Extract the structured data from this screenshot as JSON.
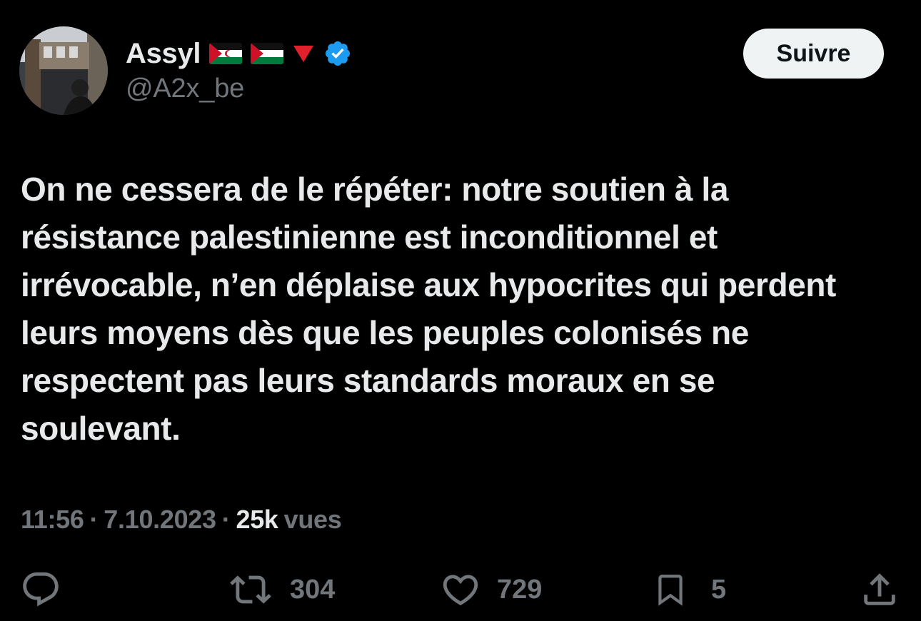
{
  "header": {
    "display_name": "Assyl",
    "handle": "@A2x_be",
    "follow_label": "Suivre",
    "name_emojis": [
      "flag-western-sahara-icon",
      "flag-palestine-icon",
      "red-triangle-down-icon",
      "verified-badge-icon"
    ]
  },
  "tweet": {
    "lines": [
      "On ne cessera de le répéter: notre soutien à la",
      "résistance palestinienne est inconditionnel et",
      "irrévocable, n’en déplaise aux hypocrites qui perdent",
      "leurs moyens dès que les peuples colonisés ne",
      "respectent pas leurs standards moraux en se",
      "soulevant."
    ]
  },
  "meta": {
    "time": "11:56",
    "separator": "·",
    "date": "7.10.2023",
    "views_count": "25k",
    "views_label": "vues"
  },
  "actions": {
    "reply": {
      "icon": "reply-icon",
      "count": ""
    },
    "retweet": {
      "icon": "retweet-icon",
      "count": "304"
    },
    "like": {
      "icon": "heart-icon",
      "count": "729"
    },
    "bookmark": {
      "icon": "bookmark-icon",
      "count": "5"
    },
    "share": {
      "icon": "share-icon",
      "count": ""
    }
  },
  "colors": {
    "background": "#000000",
    "text_primary": "#e7e9ea",
    "text_secondary": "#71767b",
    "verified_blue": "#1d9bf0",
    "follow_bg": "#eff3f4",
    "follow_text": "#0f1419"
  }
}
